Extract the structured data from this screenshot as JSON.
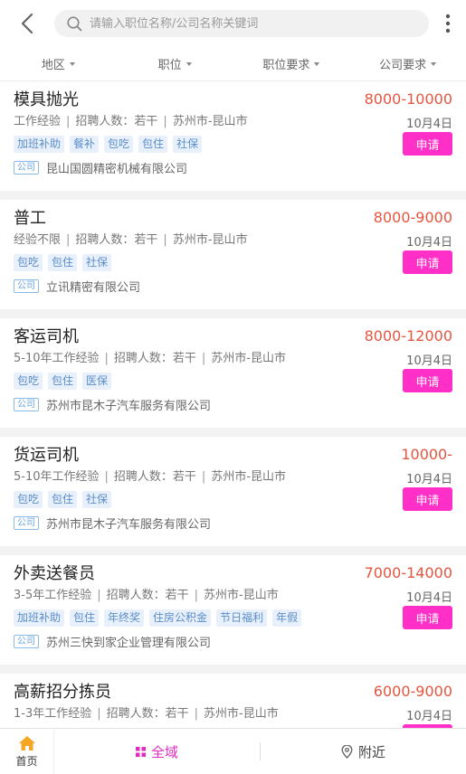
{
  "header": {
    "search_placeholder": "请输入职位名称/公司名称关键词"
  },
  "filters": [
    "地区",
    "职位",
    "职位要求",
    "公司要求"
  ],
  "company_badge": "公司",
  "apply_label": "申请",
  "jobs": [
    {
      "title": "模具抛光",
      "experience": "工作经验",
      "recruit": "招聘人数：若干",
      "location": "苏州市-昆山市",
      "tags": [
        "加班补助",
        "餐补",
        "包吃",
        "包住",
        "社保"
      ],
      "company": "昆山国圆精密机械有限公司",
      "salary": "8000-10000",
      "date": "10月4日"
    },
    {
      "title": "普工",
      "experience": "经验不限",
      "recruit": "招聘人数：若干",
      "location": "苏州市-昆山市",
      "tags": [
        "包吃",
        "包住",
        "社保"
      ],
      "company": "立讯精密有限公司",
      "salary": "8000-9000",
      "date": "10月4日"
    },
    {
      "title": "客运司机",
      "experience": "5-10年工作经验",
      "recruit": "招聘人数：若干",
      "location": "苏州市-昆山市",
      "tags": [
        "包吃",
        "包住",
        "医保"
      ],
      "company": "苏州市昆木子汽车服务有限公司",
      "salary": "8000-12000",
      "date": "10月4日"
    },
    {
      "title": "货运司机",
      "experience": "5-10年工作经验",
      "recruit": "招聘人数：若干",
      "location": "苏州市-昆山市",
      "tags": [
        "包吃",
        "包住",
        "社保"
      ],
      "company": "苏州市昆木子汽车服务有限公司",
      "salary": "10000-",
      "date": "10月4日"
    },
    {
      "title": "外卖送餐员",
      "experience": "3-5年工作经验",
      "recruit": "招聘人数：若干",
      "location": "苏州市-昆山市",
      "tags": [
        "加班补助",
        "包住",
        "年终奖",
        "住房公积金",
        "节日福利",
        "年假"
      ],
      "company": "苏州三快到家企业管理有限公司",
      "salary": "7000-14000",
      "date": "10月4日"
    },
    {
      "title": "高薪招分拣员",
      "experience": "1-3年工作经验",
      "recruit": "招聘人数：若干",
      "location": "苏州市-昆山市",
      "tags": [],
      "company": "",
      "salary": "6000-9000",
      "date": "10月4日"
    }
  ],
  "bottom_nav": {
    "home": "首页",
    "all": "全域",
    "nearby": "附近"
  },
  "colors": {
    "accent": "#ff2fc8",
    "salary": "#e5553f",
    "tag_bg": "#e8f1fb",
    "home_icon": "#f5a623"
  }
}
